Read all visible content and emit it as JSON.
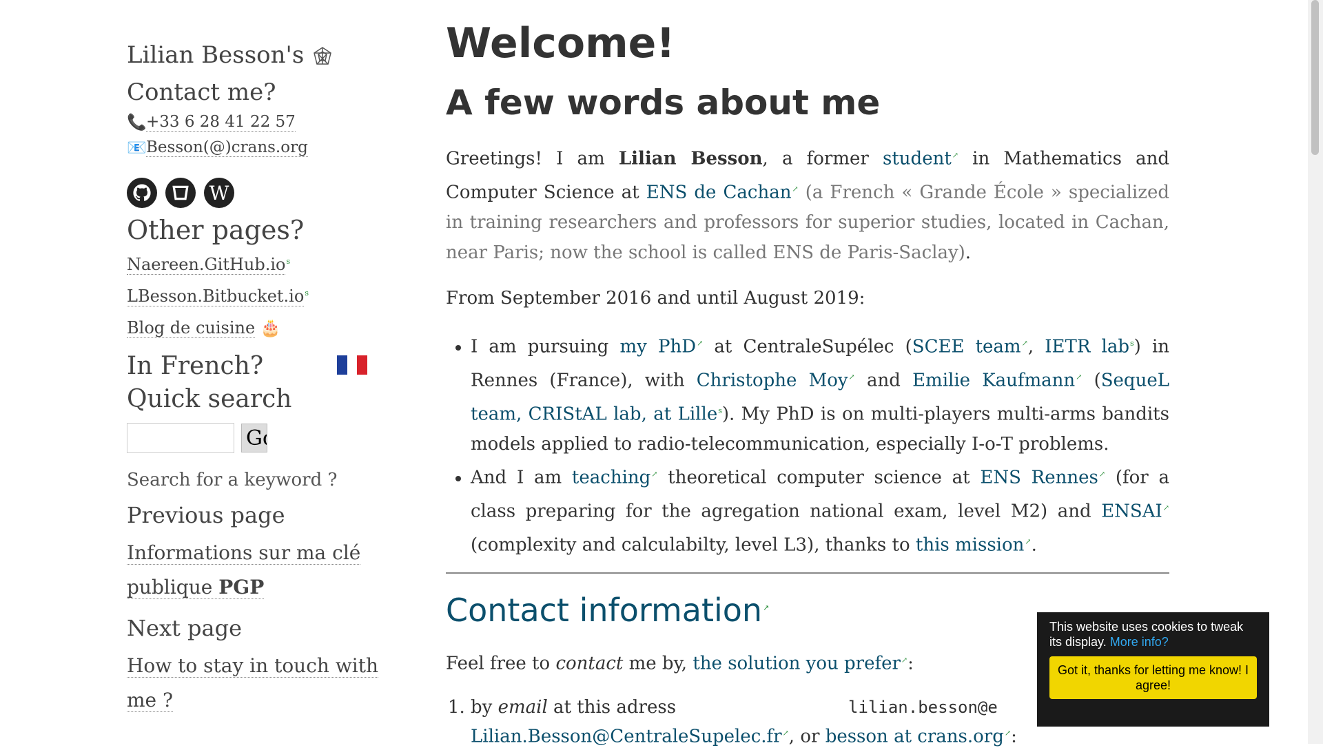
{
  "sidebar": {
    "title": "Lilian Besson's",
    "title_icon": "web-icon",
    "contact_heading": "Contact me?",
    "phone": "+33 6 28 41 22 57",
    "email": "Besson(@)crans.org",
    "social_icons": [
      "github-icon",
      "bitbucket-icon",
      "wordpress-icon"
    ],
    "other_heading": "Other pages?",
    "other_links": [
      "Naereen.GitHub.io",
      "LBesson.Bitbucket.io",
      "Blog de cuisine"
    ],
    "other_link_marks": [
      "s",
      "s",
      ""
    ],
    "french_heading": "In French?",
    "search_heading": "Quick search",
    "go_label": "Go",
    "search_hint": "Search for a keyword ?",
    "prev_heading": "Previous page",
    "prev_link_part1": "Informations sur ma clé publique",
    "prev_link_bold": "PGP",
    "next_heading": "Next page",
    "next_link": "How to stay in touch with me ?",
    "flag_colors": [
      "#1e3f9a",
      "#ffffff",
      "#d8222b"
    ]
  },
  "main": {
    "welcome": "Welcome!",
    "about_heading": "A few words about me",
    "p1": {
      "t1": "Greetings! I am ",
      "name": "Lilian Besson",
      "t2": ", a former ",
      "link_student": "student",
      "t3": " in Mathematics and Computer Science at ",
      "link_ens": "ENS de Cachan",
      "muted": " (a French « Grande École » specialized in training researchers and professors for superior studies, located in Cachan, near Paris; now the school is called ENS de Paris-Saclay)",
      "t4": "."
    },
    "p2": "From September 2016 and until August 2019:",
    "li1": {
      "t1": "I am pursuing ",
      "link_phd": "my PhD",
      "t2": " at CentraleSupélec (",
      "link_scee": "SCEE team",
      "t3": ", ",
      "link_ietr": "IETR lab",
      "t4": ") in Rennes (France), with ",
      "link_moy": "Christophe Moy",
      "t5": " and ",
      "link_kaufmann": "Emilie Kaufmann",
      "t6": " (",
      "link_sequel": "SequeL team, CRIStAL lab, at Lille",
      "t7": "). My PhD is on multi-players multi-arms bandits models applied to radio-telecommunication, especially I-o-T problems."
    },
    "li2": {
      "t1": "And I am ",
      "link_teaching": "teaching",
      "t2": " theoretical computer science at ",
      "link_ens_rennes": "ENS Rennes",
      "t3": " (for a class preparing for the agregation national exam, level M2) and ",
      "link_ensai": "ENSAI",
      "t4": " (complexity and calculabilty, level L3), thanks to ",
      "link_mission": "this mission",
      "t5": "."
    },
    "contact_heading": "Contact information",
    "p3": {
      "t1": "Feel free to ",
      "em": "contact",
      "t2": " me by, ",
      "link": "the solution you prefer",
      "t3": ":"
    },
    "ol1": {
      "t1": "by ",
      "em": "email",
      "t2": " at this adress",
      "mono": "lilian.besson@e",
      "link1": "Lilian.Besson@CentraleSupelec.fr",
      "t3": ", or ",
      "link2": "besson at crans.org",
      "t4": ":"
    }
  },
  "cookie": {
    "text": "This website uses cookies to tweak its display.",
    "more": "More info?",
    "button": "Got it, thanks for letting me know! I agree!"
  },
  "ext_mark": "↗"
}
